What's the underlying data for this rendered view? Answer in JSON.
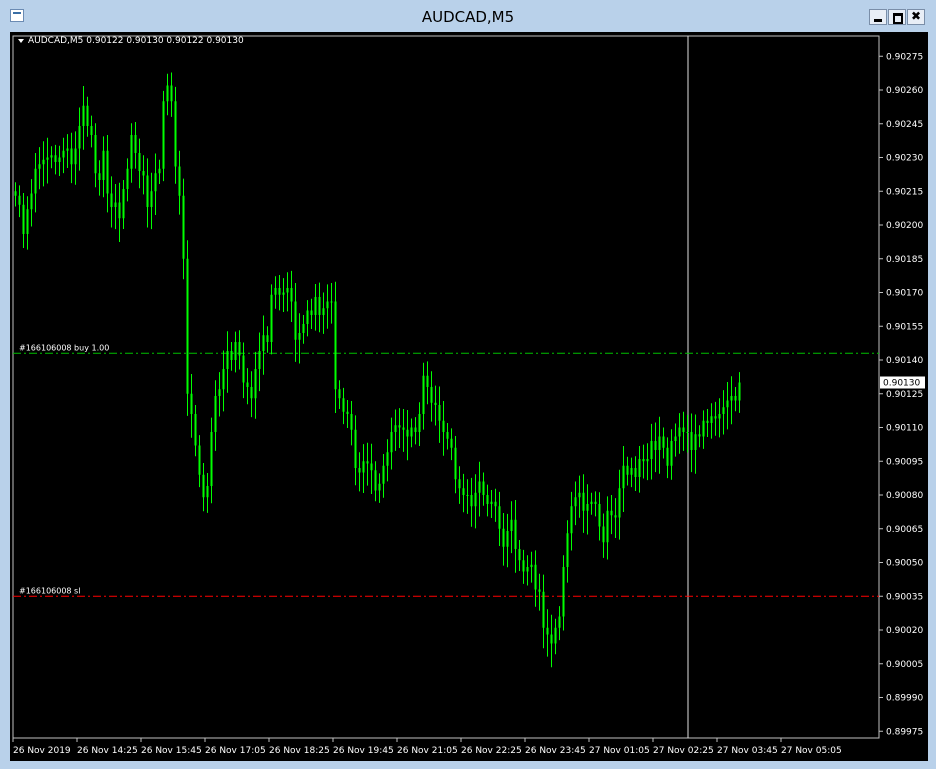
{
  "window": {
    "title": "AUDCAD,M5"
  },
  "header": {
    "symbol_line": "AUDCAD,M5  0.90122 0.90130 0.90122 0.90130"
  },
  "colors": {
    "background": "#000000",
    "candle": "#00ff00",
    "buy_line": "#00c000",
    "sl_line": "#ff0000",
    "axis": "#c0c0c0",
    "text": "#ffffff"
  },
  "chart_data": {
    "type": "candlestick",
    "symbol": "AUDCAD",
    "timeframe": "M5",
    "last_price": "0.90130",
    "ylim": [
      0.8997,
      0.90285
    ],
    "y_ticks": [
      "0.90275",
      "0.90260",
      "0.90245",
      "0.90230",
      "0.90215",
      "0.90200",
      "0.90185",
      "0.90170",
      "0.90155",
      "0.90140",
      "0.90125",
      "0.90110",
      "0.90095",
      "0.90080",
      "0.90065",
      "0.90050",
      "0.90035",
      "0.90020",
      "0.90005",
      "0.89990",
      "0.89975"
    ],
    "x_ticks": [
      "26 Nov 2019",
      "26 Nov 14:25",
      "26 Nov 15:45",
      "26 Nov 17:05",
      "26 Nov 18:25",
      "26 Nov 19:45",
      "26 Nov 21:05",
      "26 Nov 22:25",
      "26 Nov 23:45",
      "27 Nov 01:05",
      "27 Nov 02:25",
      "27 Nov 03:45",
      "27 Nov 05:05"
    ],
    "bars_per_tick": 16,
    "lines": [
      {
        "label": "#166106008 buy 1.00",
        "price": 0.90143,
        "style": "dash-dot",
        "color": "#00c000"
      },
      {
        "label": "#166106008 sl",
        "price": 0.90035,
        "style": "dash-dot",
        "color": "#ff0000"
      }
    ],
    "closes": [
      0.90213,
      0.90209,
      0.90196,
      0.90207,
      0.90214,
      0.90225,
      0.90227,
      0.90229,
      0.9023,
      0.90231,
      0.90228,
      0.9023,
      0.90233,
      0.90234,
      0.90227,
      0.90234,
      0.90244,
      0.90253,
      0.90244,
      0.9024,
      0.90223,
      0.9022,
      0.90233,
      0.90214,
      0.90208,
      0.9021,
      0.90203,
      0.90216,
      0.90225,
      0.9024,
      0.90232,
      0.90224,
      0.90222,
      0.90208,
      0.90215,
      0.90223,
      0.90225,
      0.90255,
      0.90262,
      0.90255,
      0.90226,
      0.90213,
      0.90185,
      0.90125,
      0.90116,
      0.90102,
      0.90089,
      0.90079,
      0.90084,
      0.90108,
      0.90124,
      0.90127,
      0.90136,
      0.90144,
      0.9014,
      0.90148,
      0.90142,
      0.9013,
      0.90128,
      0.90123,
      0.90136,
      0.90144,
      0.90151,
      0.90148,
      0.90169,
      0.90172,
      0.90169,
      0.9017,
      0.90172,
      0.90166,
      0.90149,
      0.90152,
      0.90156,
      0.90162,
      0.9016,
      0.90168,
      0.9016,
      0.90163,
      0.90166,
      0.90166,
      0.90127,
      0.90123,
      0.90117,
      0.90116,
      0.90109,
      0.90092,
      0.9009,
      0.90095,
      0.90094,
      0.90091,
      0.90082,
      0.90085,
      0.90093,
      0.90099,
      0.90108,
      0.90111,
      0.9011,
      0.90109,
      0.90106,
      0.9011,
      0.90108,
      0.90116,
      0.90133,
      0.90128,
      0.90121,
      0.9012,
      0.90113,
      0.90108,
      0.90105,
      0.90101,
      0.90087,
      0.90083,
      0.9008,
      0.9008,
      0.90075,
      0.90081,
      0.90086,
      0.9008,
      0.90076,
      0.90077,
      0.90075,
      0.90065,
      0.90057,
      0.90064,
      0.90069,
      0.90056,
      0.90051,
      0.90046,
      0.90048,
      0.90049,
      0.90038,
      0.90037,
      0.90021,
      0.90018,
      0.90014,
      0.90021,
      0.90026,
      0.90048,
      0.90063,
      0.90075,
      0.90079,
      0.90081,
      0.90073,
      0.90076,
      0.90077,
      0.90076,
      0.90066,
      0.90059,
      0.90073,
      0.90071,
      0.9007,
      0.90083,
      0.90093,
      0.90089,
      0.90092,
      0.90088,
      0.90096,
      0.90095,
      0.90096,
      0.90104,
      0.901,
      0.90106,
      0.90101,
      0.90093,
      0.90104,
      0.90106,
      0.9011,
      0.90108,
      0.90108,
      0.901,
      0.90107,
      0.90106,
      0.90113,
      0.90112,
      0.90115,
      0.90114,
      0.90116,
      0.90119,
      0.90122,
      0.90124,
      0.90122,
      0.9013
    ]
  }
}
